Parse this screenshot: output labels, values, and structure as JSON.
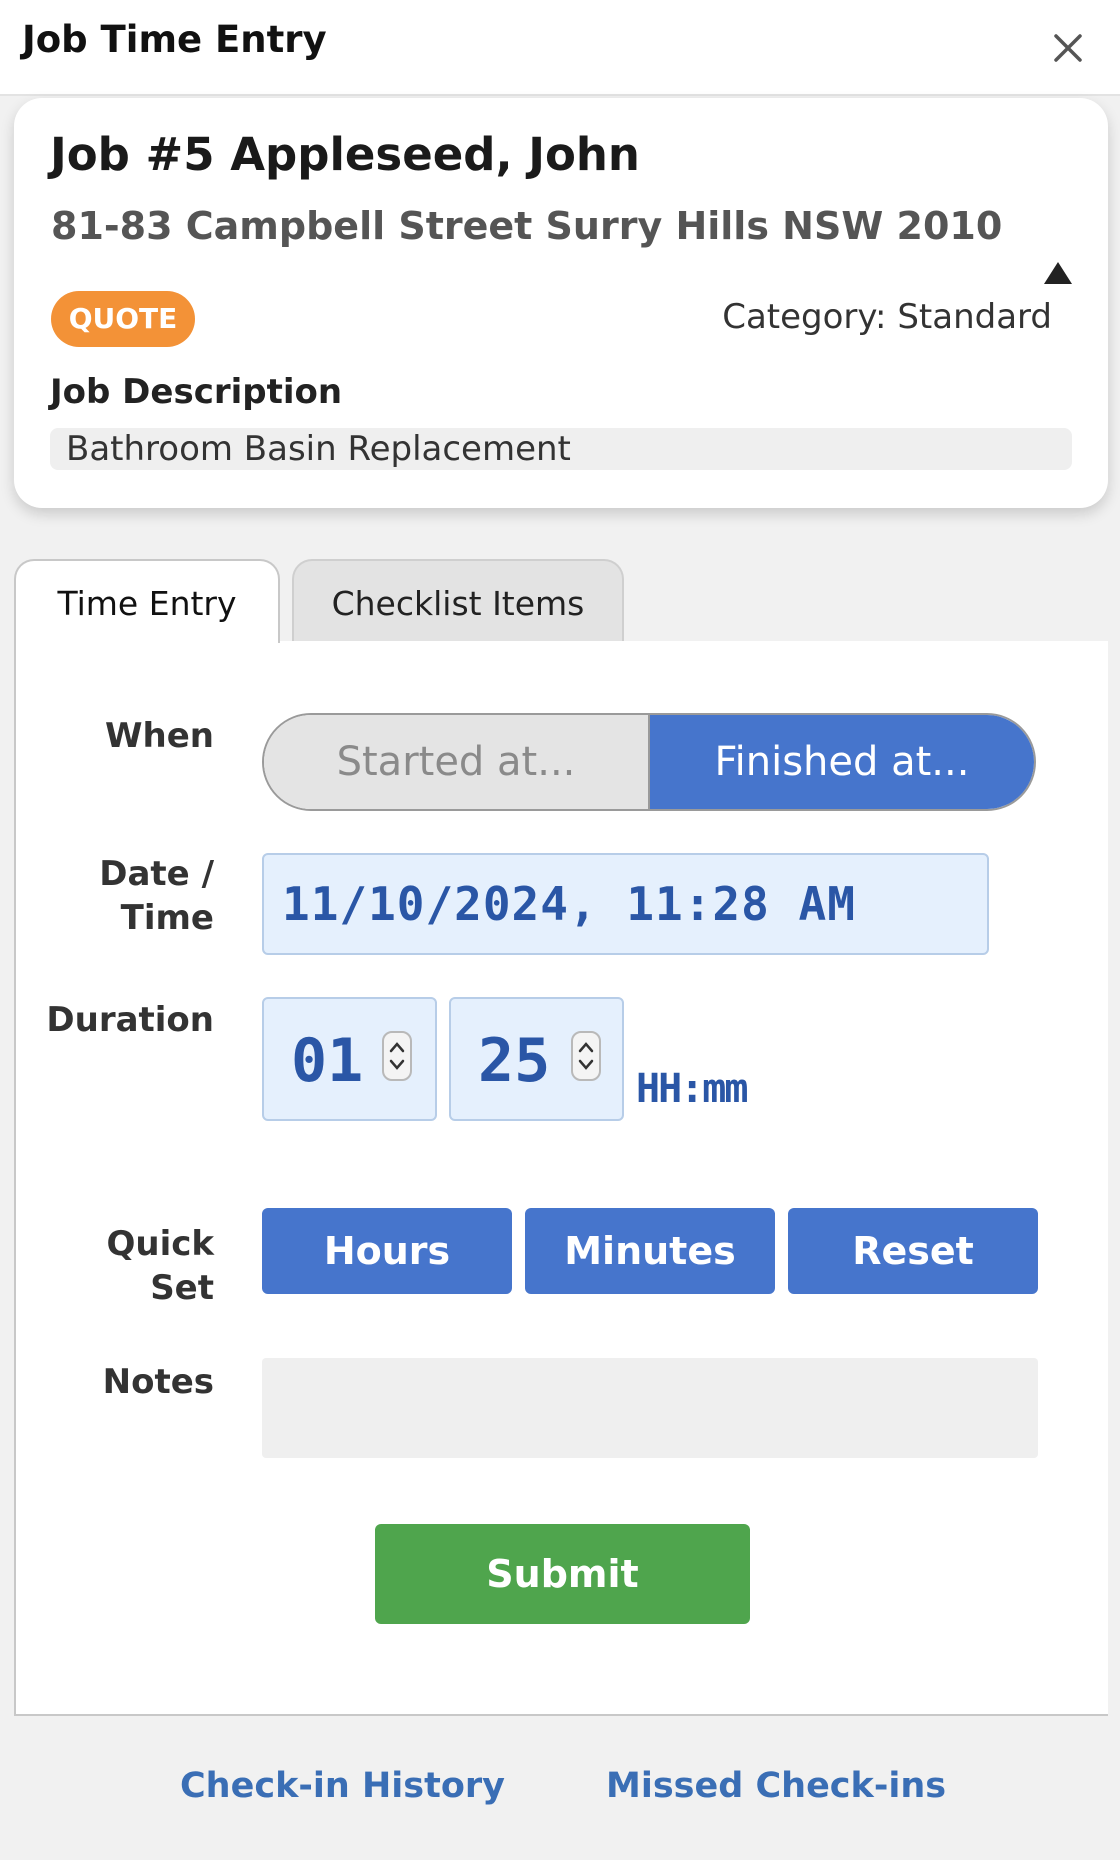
{
  "header": {
    "title": "Job Time Entry",
    "close_icon": "close-icon"
  },
  "job": {
    "title": "Job #5 Appleseed, John",
    "address": "81-83 Campbell Street Surry Hills NSW 2010",
    "status": "QUOTE",
    "status_color": "#f39237",
    "category": "Category: Standard",
    "description_label": "Job Description",
    "description": "Bathroom Basin Replacement",
    "collapse_icon": "triangle-up-icon"
  },
  "tabs": [
    {
      "label": "Time Entry",
      "active": true
    },
    {
      "label": "Checklist Items",
      "active": false
    }
  ],
  "form": {
    "when_label": "When",
    "when_options": [
      "Started at...",
      "Finished at..."
    ],
    "when_selected": "Finished at...",
    "datetime_label_line1": "Date /",
    "datetime_label_line2": "Time",
    "datetime_value": "11/10/2024, 11:28 AM",
    "duration_label": "Duration",
    "duration_hours": "01",
    "duration_minutes": "25",
    "duration_unit": "HH:mm",
    "quickset_label_line1": "Quick",
    "quickset_label_line2": "Set",
    "quickset_buttons": [
      "Hours",
      "Minutes",
      "Reset"
    ],
    "notes_label": "Notes",
    "notes_value": "",
    "submit_label": "Submit"
  },
  "footer": {
    "links": [
      "Check-in History",
      "Missed Check-ins"
    ]
  },
  "colors": {
    "accent_blue": "#4675cc",
    "submit_green": "#4fa54d",
    "input_bg": "#e5f0fd",
    "link_blue": "#3a6eb5"
  }
}
